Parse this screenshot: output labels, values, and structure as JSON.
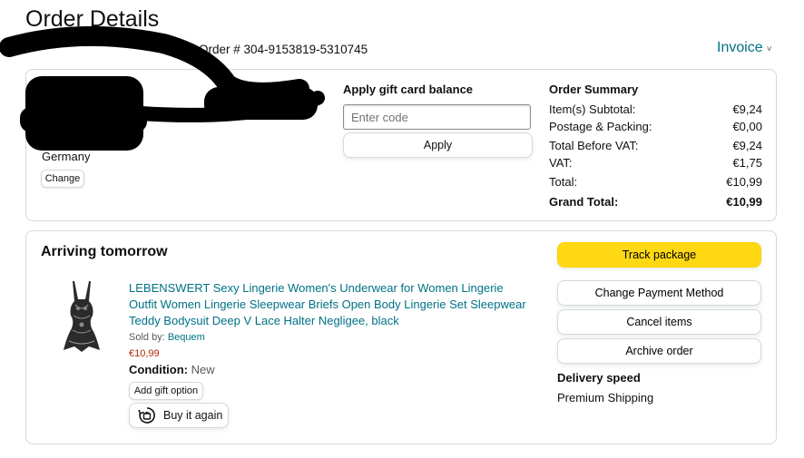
{
  "header": {
    "title": "Order Details",
    "order_number": "Order # 304-9153819-5310745",
    "invoice_label": "Invoice",
    "invoice_chevron": "˅"
  },
  "shipping_address": {
    "country": "Germany",
    "change_label": "Change"
  },
  "gift_card": {
    "title": "Apply gift card balance",
    "placeholder": "Enter code",
    "apply_label": "Apply"
  },
  "order_summary": {
    "title": "Order Summary",
    "rows": [
      {
        "label": "Item(s) Subtotal:",
        "value": "€9,24"
      },
      {
        "label": "Postage & Packing:",
        "value": "€0,00"
      },
      {
        "label": "Total Before VAT:",
        "value": "€9,24"
      },
      {
        "label": "VAT:",
        "value": "€1,75"
      },
      {
        "label": "Total:",
        "value": "€10,99"
      }
    ],
    "grand_total_label": "Grand Total:",
    "grand_total_value": "€10,99"
  },
  "shipment": {
    "status_title": "Arriving tomorrow",
    "product": {
      "title": "LEBENSWERT Sexy Lingerie Women's Underwear for Women Lingerie Outfit Women Lingerie Sleepwear Briefs Open Body Lingerie Set Sleepwear Teddy Bodysuit Deep V Lace Halter Negligee, black",
      "sold_by_label": "Sold by:",
      "seller": "Bequem",
      "price": "€10,99",
      "condition_label": "Condition:",
      "condition_value": "New",
      "gift_option_label": "Add gift option",
      "buy_again_label": "Buy it again"
    },
    "actions": {
      "track": "Track package",
      "change_payment": "Change Payment Method",
      "cancel": "Cancel items",
      "archive": "Archive order"
    },
    "delivery_speed_label": "Delivery speed",
    "delivery_speed_value": "Premium Shipping"
  },
  "colors": {
    "link": "#007185",
    "price": "#b12704",
    "track_button": "#ffd814",
    "border": "#d5d9d9"
  },
  "icons": {
    "invoice_chevron": "chevron-down-icon",
    "buy_again": "reorder-icon"
  }
}
